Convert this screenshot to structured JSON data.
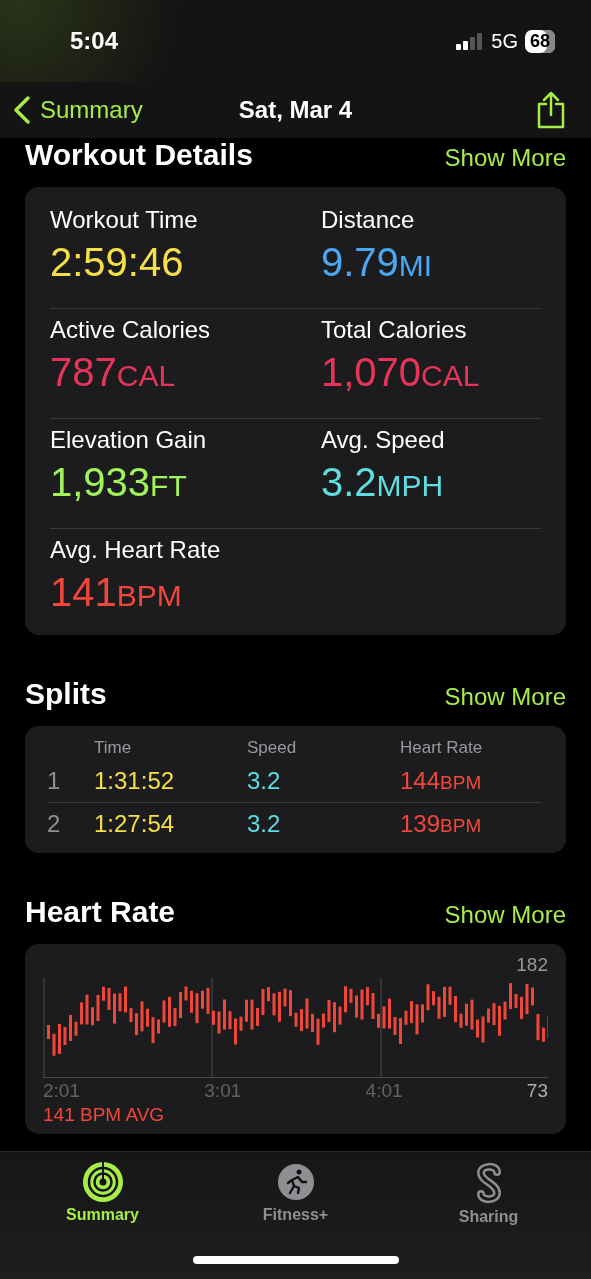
{
  "status_bar": {
    "time": "5:04",
    "network": "5G",
    "battery": "68"
  },
  "nav": {
    "back": "Summary",
    "title": "Sat, Mar 4"
  },
  "workout_details": {
    "title": "Workout Details",
    "action": "Show More",
    "metrics": [
      {
        "label": "Workout Time",
        "value": "2:59:46",
        "color": "#f5e04a"
      },
      {
        "label": "Distance",
        "value": "9.79",
        "unit": "MI",
        "color": "#4aa8f0"
      },
      {
        "label": "Active Calories",
        "value": "787",
        "unit": "CAL",
        "color": "#e8345a"
      },
      {
        "label": "Total Calories",
        "value": "1,070",
        "unit": "CAL",
        "color": "#e8345a"
      },
      {
        "label": "Elevation Gain",
        "value": "1,933",
        "unit": "FT",
        "color": "#a2f25c"
      },
      {
        "label": "Avg. Speed",
        "value": "3.2",
        "unit": "MPH",
        "color": "#5fdde0"
      },
      {
        "label": "Avg. Heart Rate",
        "value": "141",
        "unit": "BPM",
        "color": "#f0473a"
      }
    ]
  },
  "splits": {
    "title": "Splits",
    "action": "Show More",
    "columns": [
      "Time",
      "Speed",
      "Heart Rate"
    ],
    "rows": [
      {
        "index": "1",
        "time": "1:31:52",
        "speed": "3.2",
        "heart_rate": "144",
        "unit": "BPM"
      },
      {
        "index": "2",
        "time": "1:27:54",
        "speed": "3.2",
        "heart_rate": "139",
        "unit": "BPM"
      }
    ]
  },
  "heart_rate": {
    "title": "Heart Rate",
    "action": "Show More",
    "max": "182",
    "min": "73",
    "x_labels": [
      "2:01",
      "3:01",
      "4:01"
    ],
    "average": "141 BPM AVG"
  },
  "tabs": [
    {
      "label": "Summary",
      "selected": true
    },
    {
      "label": "Fitness+",
      "selected": false
    },
    {
      "label": "Sharing",
      "selected": false
    }
  ]
}
